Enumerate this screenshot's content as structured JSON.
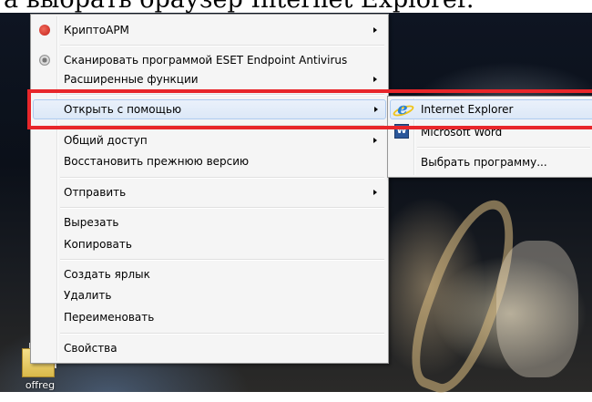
{
  "caption": {
    "text": "а выбрать браузер Internet Explorer."
  },
  "desktop": {
    "icon_label": "offreg"
  },
  "context_menu": {
    "items": [
      {
        "label": "КриптоАРМ",
        "icon": "cryptoarm-icon",
        "has_submenu": true
      },
      {
        "label": "Сканировать программой ESET Endpoint Antivirus",
        "icon": "eset-icon",
        "has_submenu": false
      },
      {
        "label": "Расширенные функции",
        "has_submenu": true
      },
      {
        "label": "Открыть с помощью",
        "has_submenu": true,
        "highlighted": true
      },
      {
        "label": "Общий доступ",
        "has_submenu": true
      },
      {
        "label": "Восстановить прежнюю версию",
        "has_submenu": false
      },
      {
        "label": "Отправить",
        "has_submenu": true
      },
      {
        "label": "Вырезать",
        "has_submenu": false
      },
      {
        "label": "Копировать",
        "has_submenu": false
      },
      {
        "label": "Создать ярлык",
        "has_submenu": false
      },
      {
        "label": "Удалить",
        "has_submenu": false
      },
      {
        "label": "Переименовать",
        "has_submenu": false
      },
      {
        "label": "Свойства",
        "has_submenu": false
      }
    ]
  },
  "submenu": {
    "items": [
      {
        "label": "Internet Explorer",
        "icon": "internet-explorer-icon",
        "highlighted": true
      },
      {
        "label": "Microsoft Word",
        "icon": "word-icon"
      },
      {
        "label": "Выбрать программу..."
      }
    ]
  },
  "icons": {
    "word_letter": "W",
    "ie_letter": "e"
  },
  "colors": {
    "annotation_red": "#e8262a",
    "hover_bg": "#dce8f7",
    "hover_border": "#aecbf0"
  }
}
